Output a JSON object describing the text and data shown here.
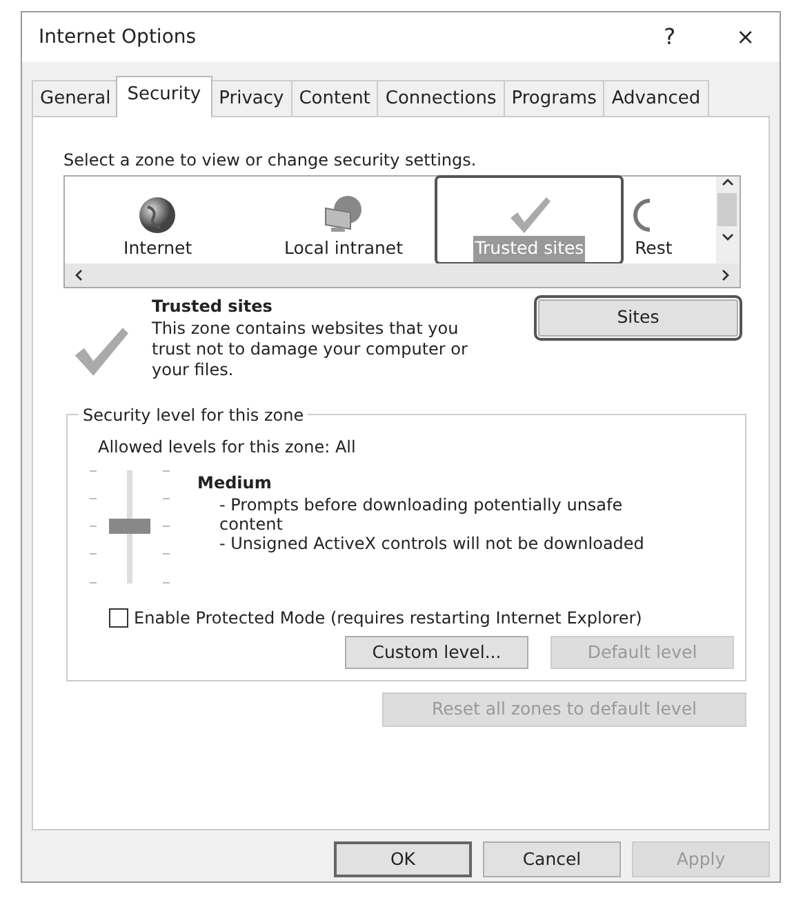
{
  "window": {
    "title": "Internet Options",
    "help": "?",
    "close": "×"
  },
  "tabs": [
    {
      "label": "General",
      "selected": false
    },
    {
      "label": "Security",
      "selected": true
    },
    {
      "label": "Privacy",
      "selected": false
    },
    {
      "label": "Content",
      "selected": false
    },
    {
      "label": "Connections",
      "selected": false
    },
    {
      "label": "Programs",
      "selected": false
    },
    {
      "label": "Advanced",
      "selected": false
    }
  ],
  "zone_prompt": "Select a zone to view or change security settings.",
  "zones": [
    {
      "kind": "globe",
      "label": "Internet",
      "selected": false
    },
    {
      "kind": "intranet",
      "label": "Local intranet",
      "selected": false
    },
    {
      "kind": "check",
      "label": "Trusted sites",
      "selected": true
    },
    {
      "kind": "restricted",
      "label": "Rest",
      "selected": false
    }
  ],
  "zone_info": {
    "title": "Trusted sites",
    "description": "This zone contains websites that you trust not to damage your computer or your files.",
    "button": "Sites"
  },
  "security_level": {
    "legend": "Security level for this zone",
    "allowed": "Allowed levels for this zone: All",
    "level": 0.5,
    "name": "Medium",
    "details": [
      "- Prompts before downloading potentially unsafe content",
      "- Unsigned ActiveX controls will not be downloaded"
    ],
    "protected_mode": {
      "label": "Enable Protected Mode (requires restarting Internet Explorer)",
      "checked": false
    },
    "buttons": [
      {
        "label": "Custom level...",
        "disabled": false
      },
      {
        "label": "Default level",
        "disabled": true
      }
    ]
  },
  "reset_button": {
    "label": "Reset all zones to default level",
    "disabled": true
  },
  "buttons": [
    {
      "label": "OK",
      "disabled": false,
      "default": true
    },
    {
      "label": "Cancel",
      "disabled": false,
      "default": false
    },
    {
      "label": "Apply",
      "disabled": true,
      "default": false
    }
  ]
}
